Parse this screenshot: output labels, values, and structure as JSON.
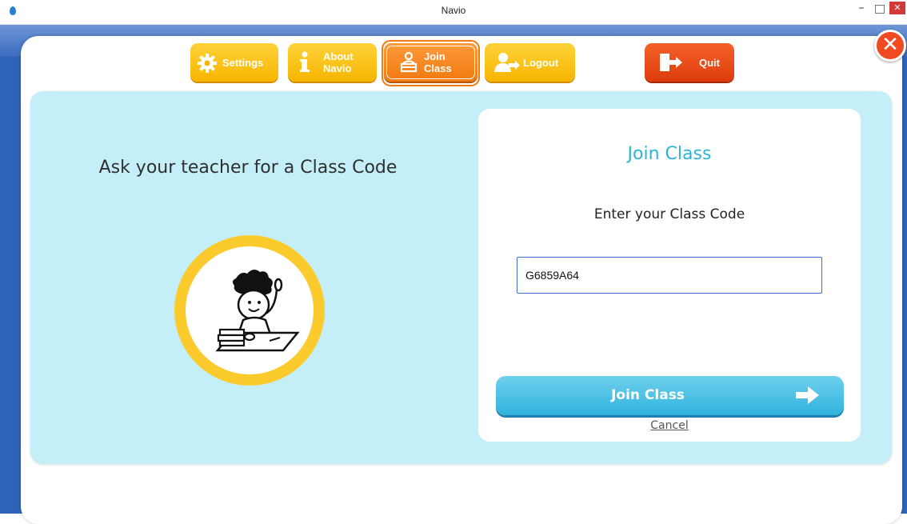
{
  "window": {
    "title": "Navio"
  },
  "nav": {
    "settings": "Settings",
    "about_line1": "About",
    "about_line2": "Navio",
    "join_line1": "Join",
    "join_line2": "Class",
    "logout": "Logout",
    "quit": "Quit"
  },
  "left": {
    "instruction": "Ask your teacher for a Class Code"
  },
  "card": {
    "title": "Join Class",
    "subtitle": "Enter your Class Code",
    "code_value": "G6859A64",
    "join_button": "Join Class",
    "cancel": "Cancel"
  },
  "colors": {
    "nav_yellow": "#f7b500",
    "nav_active": "#f07a10",
    "quit_red": "#de3b0c",
    "content_bg": "#c5eff8",
    "accent_teal": "#2ab5d6"
  }
}
